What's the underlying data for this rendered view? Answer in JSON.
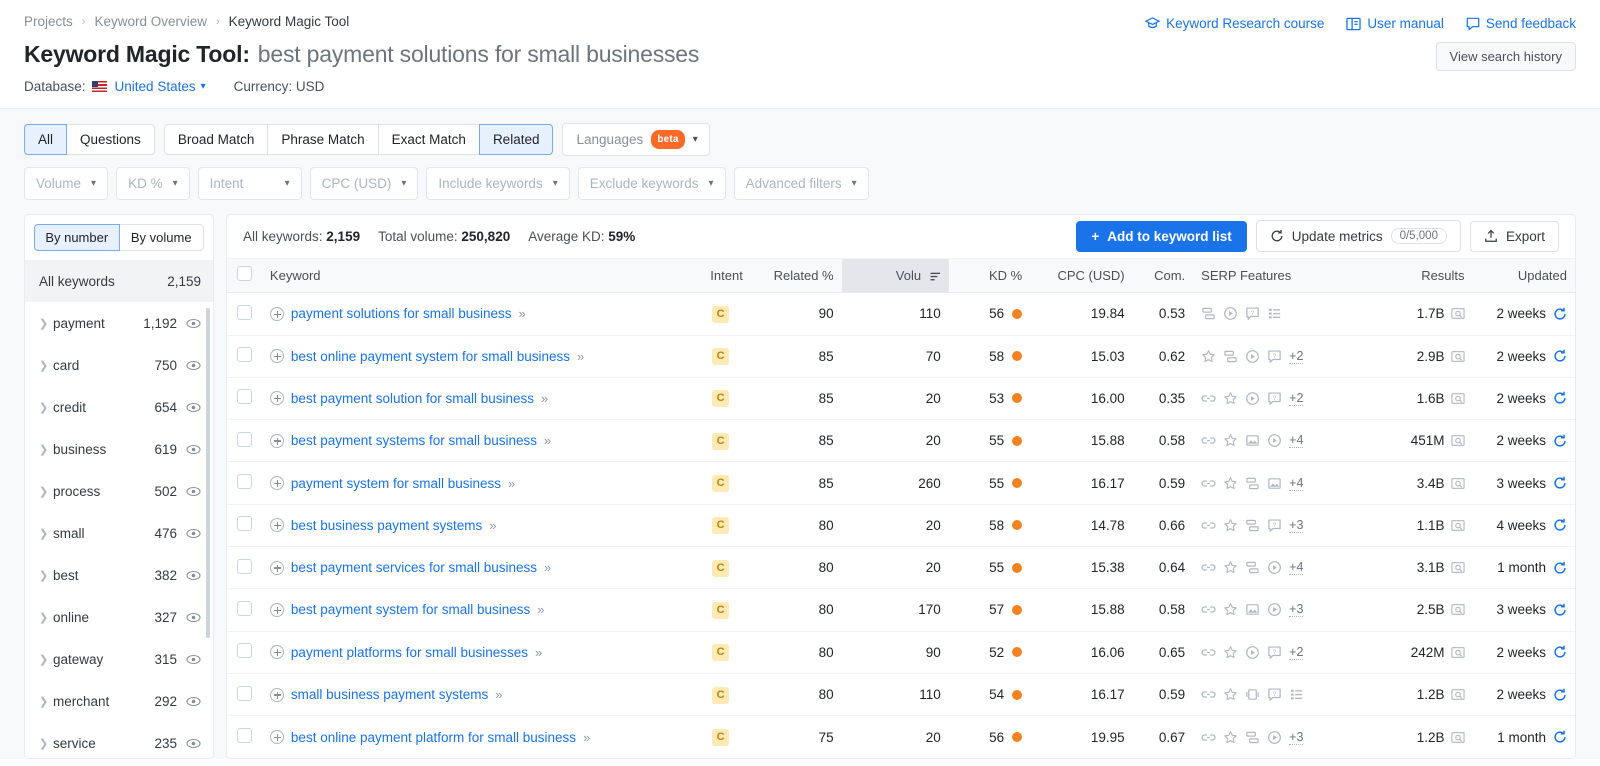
{
  "breadcrumb": {
    "items": [
      "Projects",
      "Keyword Overview",
      "Keyword Magic Tool"
    ],
    "sep": "›"
  },
  "header": {
    "title_main": "Keyword Magic Tool:",
    "title_query": "best payment solutions for small businesses",
    "database_label": "Database:",
    "database_value": "United States",
    "currency": "Currency: USD",
    "links": [
      {
        "label": "Keyword Research course",
        "icon": "graduation-cap-icon"
      },
      {
        "label": "User manual",
        "icon": "book-icon"
      },
      {
        "label": "Send feedback",
        "icon": "speech-bubble-icon"
      }
    ],
    "history_button": "View search history"
  },
  "filters": {
    "match_tabs": [
      "All",
      "Questions"
    ],
    "match_tabs2": [
      "Broad Match",
      "Phrase Match",
      "Exact Match",
      "Related"
    ],
    "active_tabs": [
      "All",
      "Related"
    ],
    "languages": {
      "label": "Languages",
      "badge": "beta"
    },
    "dropdowns": [
      "Volume",
      "KD %",
      "Intent",
      "CPC (USD)",
      "Include keywords",
      "Exclude keywords",
      "Advanced filters"
    ]
  },
  "sidebar": {
    "toggle": [
      "By number",
      "By volume"
    ],
    "toggle_active": "By number",
    "all_keywords": {
      "label": "All keywords",
      "count": "2,159"
    },
    "groups": [
      {
        "label": "payment",
        "count": "1,192"
      },
      {
        "label": "card",
        "count": "750"
      },
      {
        "label": "credit",
        "count": "654"
      },
      {
        "label": "business",
        "count": "619"
      },
      {
        "label": "process",
        "count": "502"
      },
      {
        "label": "small",
        "count": "476"
      },
      {
        "label": "best",
        "count": "382"
      },
      {
        "label": "online",
        "count": "327"
      },
      {
        "label": "gateway",
        "count": "315"
      },
      {
        "label": "merchant",
        "count": "292"
      },
      {
        "label": "service",
        "count": "235"
      }
    ]
  },
  "stats": {
    "all_keywords_label": "All keywords:",
    "all_keywords_value": "2,159",
    "total_volume_label": "Total volume:",
    "total_volume_value": "250,820",
    "average_kd_label": "Average KD:",
    "average_kd_value": "59%"
  },
  "actions": {
    "add_to_list": "Add to keyword list",
    "update_metrics": "Update metrics",
    "update_metrics_quota": "0/5,000",
    "export": "Export"
  },
  "table": {
    "columns": [
      "Keyword",
      "Intent",
      "Related %",
      "Volu",
      "KD %",
      "CPC (USD)",
      "Com.",
      "SERP Features",
      "Results",
      "Updated"
    ],
    "sorted_column": "Volu",
    "rows": [
      {
        "keyword": "payment solutions for small business",
        "intent": "C",
        "related": "90",
        "volume": "110",
        "kd": "56",
        "cpc": "19.84",
        "com": "0.53",
        "serp": [
          "sitelinks",
          "video",
          "faq",
          "list"
        ],
        "serp_more": "",
        "results": "1.7B",
        "updated": "2 weeks"
      },
      {
        "keyword": "best online payment system for small business",
        "intent": "C",
        "related": "85",
        "volume": "70",
        "kd": "58",
        "cpc": "15.03",
        "com": "0.62",
        "serp": [
          "star",
          "sitelinks",
          "video",
          "faq"
        ],
        "serp_more": "+2",
        "results": "2.9B",
        "updated": "2 weeks"
      },
      {
        "keyword": "best payment solution for small business",
        "intent": "C",
        "related": "85",
        "volume": "20",
        "kd": "53",
        "cpc": "16.00",
        "com": "0.35",
        "serp": [
          "link",
          "star",
          "video",
          "faq"
        ],
        "serp_more": "+2",
        "results": "1.6B",
        "updated": "2 weeks"
      },
      {
        "keyword": "best payment systems for small business",
        "intent": "C",
        "related": "85",
        "volume": "20",
        "kd": "55",
        "cpc": "15.88",
        "com": "0.58",
        "serp": [
          "link",
          "star",
          "image",
          "video"
        ],
        "serp_more": "+4",
        "results": "451M",
        "updated": "2 weeks"
      },
      {
        "keyword": "payment system for small business",
        "intent": "C",
        "related": "85",
        "volume": "260",
        "kd": "55",
        "cpc": "16.17",
        "com": "0.59",
        "serp": [
          "link",
          "star",
          "sitelinks",
          "image"
        ],
        "serp_more": "+4",
        "results": "3.4B",
        "updated": "3 weeks"
      },
      {
        "keyword": "best business payment systems",
        "intent": "C",
        "related": "80",
        "volume": "20",
        "kd": "58",
        "cpc": "14.78",
        "com": "0.66",
        "serp": [
          "link",
          "star",
          "sitelinks",
          "faq"
        ],
        "serp_more": "+3",
        "results": "1.1B",
        "updated": "4 weeks"
      },
      {
        "keyword": "best payment services for small business",
        "intent": "C",
        "related": "80",
        "volume": "20",
        "kd": "55",
        "cpc": "15.38",
        "com": "0.64",
        "serp": [
          "link",
          "star",
          "sitelinks",
          "video"
        ],
        "serp_more": "+4",
        "results": "3.1B",
        "updated": "1 month"
      },
      {
        "keyword": "best payment system for small business",
        "intent": "C",
        "related": "80",
        "volume": "170",
        "kd": "57",
        "cpc": "15.88",
        "com": "0.58",
        "serp": [
          "link",
          "star",
          "image",
          "video"
        ],
        "serp_more": "+3",
        "results": "2.5B",
        "updated": "3 weeks"
      },
      {
        "keyword": "payment platforms for small businesses",
        "intent": "C",
        "related": "80",
        "volume": "90",
        "kd": "52",
        "cpc": "16.06",
        "com": "0.65",
        "serp": [
          "link",
          "star",
          "video",
          "faq"
        ],
        "serp_more": "+2",
        "results": "242M",
        "updated": "2 weeks"
      },
      {
        "keyword": "small business payment systems",
        "intent": "C",
        "related": "80",
        "volume": "110",
        "kd": "54",
        "cpc": "16.17",
        "com": "0.59",
        "serp": [
          "link",
          "star",
          "carousel",
          "faq",
          "list"
        ],
        "serp_more": "",
        "results": "1.2B",
        "updated": "2 weeks"
      },
      {
        "keyword": "best online payment platform for small business",
        "intent": "C",
        "related": "75",
        "volume": "20",
        "kd": "56",
        "cpc": "19.95",
        "com": "0.67",
        "serp": [
          "link",
          "star",
          "sitelinks",
          "video"
        ],
        "serp_more": "+3",
        "results": "1.2B",
        "updated": "1 month"
      }
    ]
  },
  "colors": {
    "accent": "#1a73e8",
    "kd_dot": "#f58220",
    "intent_bg": "#ffeab6",
    "beta": "#f96a29"
  }
}
